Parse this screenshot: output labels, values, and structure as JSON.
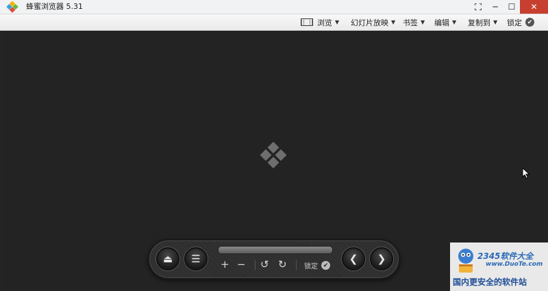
{
  "window": {
    "title": "蜂蜜浏览器 5.31",
    "controls": {
      "minimize": "─",
      "maximize": "☐",
      "close": "✕"
    }
  },
  "menubar": {
    "items": [
      {
        "label": "浏览",
        "icon": "film-icon"
      },
      {
        "label": "幻灯片放映"
      },
      {
        "label": "书签"
      },
      {
        "label": "编辑"
      },
      {
        "label": "复制到"
      }
    ],
    "lock_label": "锁定"
  },
  "controls": {
    "eject_glyph": "⏏",
    "menu_glyph": "☰",
    "zoom_in": "+",
    "zoom_out": "−",
    "rotate_left": "↺",
    "rotate_right": "↻",
    "lock_label": "锁定",
    "prev_glyph": "❮",
    "next_glyph": "❯",
    "check_glyph": "✔"
  },
  "watermark": {
    "brand": "2345软件大全",
    "url": "www.DuoTe.com",
    "slogan": "国内更安全的软件站"
  },
  "colors": {
    "background": "#242424",
    "close_button": "#c7402f",
    "watermark_blue": "#2a6ab5"
  }
}
